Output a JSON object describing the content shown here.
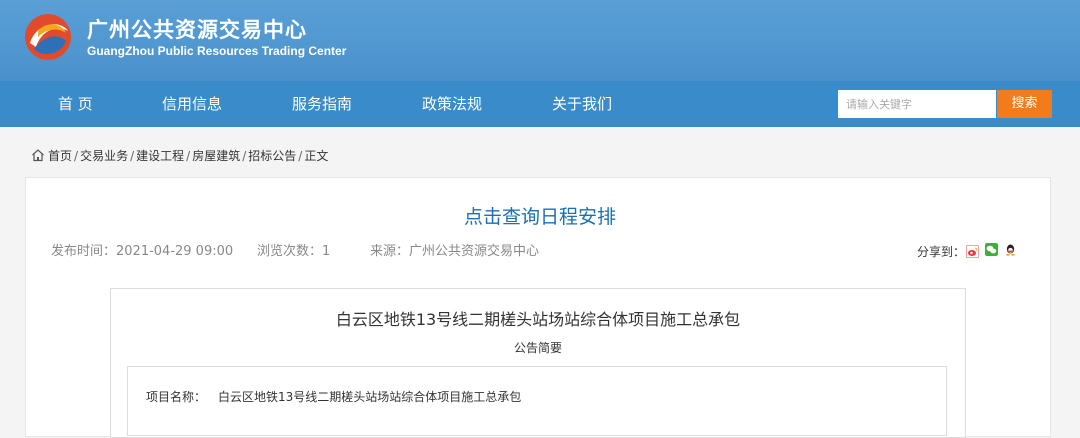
{
  "header": {
    "title": "广州公共资源交易中心",
    "subtitle": "GuangZhou Public Resources Trading Center",
    "brand_color": "#4a91cc"
  },
  "nav": {
    "items": [
      {
        "label": "首 页"
      },
      {
        "label": "信用信息"
      },
      {
        "label": "服务指南"
      },
      {
        "label": "政策法规"
      },
      {
        "label": "关于我们"
      }
    ]
  },
  "search": {
    "placeholder": "请输入关键字",
    "button_label": "搜索",
    "button_color": "#f27b1c"
  },
  "breadcrumb": {
    "items": [
      "首页",
      "交易业务",
      "建设工程",
      "房屋建筑",
      "招标公告",
      "正文"
    ],
    "separator": "/"
  },
  "article": {
    "title": "点击查询日程安排",
    "publish_time": "发布时间：2021-04-29 09:00",
    "view_count": "浏览次数：1",
    "source": "来源：广州公共资源交易中心",
    "share_label": "分享到："
  },
  "notice": {
    "title": "白云区地铁13号线二期槎头站场站综合体项目施工总承包",
    "subtitle": "公告简要",
    "project_name_label": "项目名称：",
    "project_name_value": "白云区地铁13号线二期槎头站场站综合体项目施工总承包"
  },
  "icons": {
    "home": "home-icon",
    "share_targets": [
      "weibo-icon",
      "wechat-icon",
      "qq-icon"
    ]
  }
}
